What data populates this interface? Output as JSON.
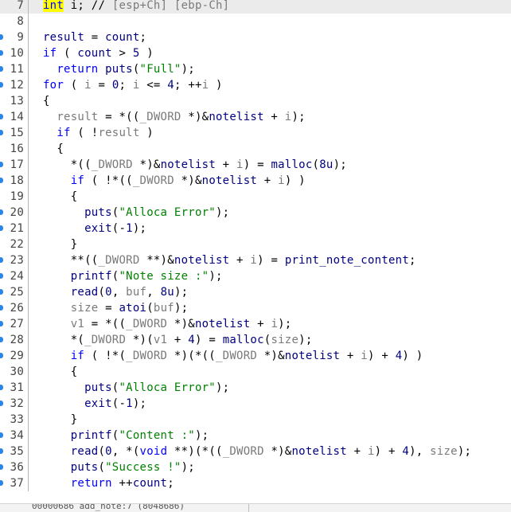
{
  "view": "pseudocode",
  "lines": [
    {
      "n": "7",
      "bp": false,
      "hl": true,
      "t": [
        [
          "hl",
          "int"
        ],
        [
          "p",
          " i; // "
        ],
        [
          "g",
          "[esp+Ch] [ebp-Ch]"
        ]
      ]
    },
    {
      "n": "8",
      "bp": false,
      "t": []
    },
    {
      "n": "9",
      "bp": true,
      "t": [
        [
          "i",
          "result"
        ],
        [
          "p",
          " = "
        ],
        [
          "i",
          "count"
        ],
        [
          "p",
          ";"
        ]
      ]
    },
    {
      "n": "10",
      "bp": true,
      "t": [
        [
          "k",
          "if"
        ],
        [
          "p",
          " ( "
        ],
        [
          "i",
          "count"
        ],
        [
          "p",
          " > "
        ],
        [
          "i",
          "5"
        ],
        [
          "p",
          " )"
        ]
      ]
    },
    {
      "n": "11",
      "bp": true,
      "t": [
        [
          "p",
          "  "
        ],
        [
          "k",
          "return"
        ],
        [
          "p",
          " "
        ],
        [
          "i",
          "puts"
        ],
        [
          "p",
          "("
        ],
        [
          "s",
          "\"Full\""
        ],
        [
          "p",
          ");"
        ]
      ]
    },
    {
      "n": "12",
      "bp": true,
      "t": [
        [
          "k",
          "for"
        ],
        [
          "p",
          " ( "
        ],
        [
          "g",
          "i"
        ],
        [
          "p",
          " = "
        ],
        [
          "i",
          "0"
        ],
        [
          "p",
          "; "
        ],
        [
          "g",
          "i"
        ],
        [
          "p",
          " <= "
        ],
        [
          "i",
          "4"
        ],
        [
          "p",
          "; ++"
        ],
        [
          "g",
          "i"
        ],
        [
          "p",
          " )"
        ]
      ]
    },
    {
      "n": "13",
      "bp": false,
      "t": [
        [
          "p",
          "{"
        ]
      ]
    },
    {
      "n": "14",
      "bp": true,
      "t": [
        [
          "p",
          "  "
        ],
        [
          "g",
          "result"
        ],
        [
          "p",
          " = *(("
        ],
        [
          "g",
          "_DWORD"
        ],
        [
          "p",
          " *)&"
        ],
        [
          "i",
          "notelist"
        ],
        [
          "p",
          " + "
        ],
        [
          "g",
          "i"
        ],
        [
          "p",
          ");"
        ]
      ]
    },
    {
      "n": "15",
      "bp": true,
      "t": [
        [
          "p",
          "  "
        ],
        [
          "k",
          "if"
        ],
        [
          "p",
          " ( !"
        ],
        [
          "g",
          "result"
        ],
        [
          "p",
          " )"
        ]
      ]
    },
    {
      "n": "16",
      "bp": false,
      "t": [
        [
          "p",
          "  {"
        ]
      ]
    },
    {
      "n": "17",
      "bp": true,
      "t": [
        [
          "p",
          "    *(("
        ],
        [
          "g",
          "_DWORD"
        ],
        [
          "p",
          " *)&"
        ],
        [
          "i",
          "notelist"
        ],
        [
          "p",
          " + "
        ],
        [
          "g",
          "i"
        ],
        [
          "p",
          ") = "
        ],
        [
          "i",
          "malloc"
        ],
        [
          "p",
          "("
        ],
        [
          "i",
          "8u"
        ],
        [
          "p",
          ");"
        ]
      ]
    },
    {
      "n": "18",
      "bp": true,
      "t": [
        [
          "p",
          "    "
        ],
        [
          "k",
          "if"
        ],
        [
          "p",
          " ( !*(("
        ],
        [
          "g",
          "_DWORD"
        ],
        [
          "p",
          " *)&"
        ],
        [
          "i",
          "notelist"
        ],
        [
          "p",
          " + "
        ],
        [
          "g",
          "i"
        ],
        [
          "p",
          ") )"
        ]
      ]
    },
    {
      "n": "19",
      "bp": false,
      "t": [
        [
          "p",
          "    {"
        ]
      ]
    },
    {
      "n": "20",
      "bp": true,
      "t": [
        [
          "p",
          "      "
        ],
        [
          "i",
          "puts"
        ],
        [
          "p",
          "("
        ],
        [
          "s",
          "\"Alloca Error\""
        ],
        [
          "p",
          ");"
        ]
      ]
    },
    {
      "n": "21",
      "bp": true,
      "t": [
        [
          "p",
          "      "
        ],
        [
          "i",
          "exit"
        ],
        [
          "p",
          "(-"
        ],
        [
          "i",
          "1"
        ],
        [
          "p",
          ");"
        ]
      ]
    },
    {
      "n": "22",
      "bp": false,
      "t": [
        [
          "p",
          "    }"
        ]
      ]
    },
    {
      "n": "23",
      "bp": true,
      "t": [
        [
          "p",
          "    **(("
        ],
        [
          "g",
          "_DWORD"
        ],
        [
          "p",
          " **)&"
        ],
        [
          "i",
          "notelist"
        ],
        [
          "p",
          " + "
        ],
        [
          "g",
          "i"
        ],
        [
          "p",
          ") = "
        ],
        [
          "i",
          "print_note_content"
        ],
        [
          "p",
          ";"
        ]
      ]
    },
    {
      "n": "24",
      "bp": true,
      "t": [
        [
          "p",
          "    "
        ],
        [
          "i",
          "printf"
        ],
        [
          "p",
          "("
        ],
        [
          "s",
          "\"Note size :\""
        ],
        [
          "p",
          ");"
        ]
      ]
    },
    {
      "n": "25",
      "bp": true,
      "t": [
        [
          "p",
          "    "
        ],
        [
          "i",
          "read"
        ],
        [
          "p",
          "("
        ],
        [
          "i",
          "0"
        ],
        [
          "p",
          ", "
        ],
        [
          "g",
          "buf"
        ],
        [
          "p",
          ", "
        ],
        [
          "i",
          "8u"
        ],
        [
          "p",
          ");"
        ]
      ]
    },
    {
      "n": "26",
      "bp": true,
      "t": [
        [
          "p",
          "    "
        ],
        [
          "g",
          "size"
        ],
        [
          "p",
          " = "
        ],
        [
          "i",
          "atoi"
        ],
        [
          "p",
          "("
        ],
        [
          "g",
          "buf"
        ],
        [
          "p",
          ");"
        ]
      ]
    },
    {
      "n": "27",
      "bp": true,
      "t": [
        [
          "p",
          "    "
        ],
        [
          "g",
          "v1"
        ],
        [
          "p",
          " = *(("
        ],
        [
          "g",
          "_DWORD"
        ],
        [
          "p",
          " *)&"
        ],
        [
          "i",
          "notelist"
        ],
        [
          "p",
          " + "
        ],
        [
          "g",
          "i"
        ],
        [
          "p",
          ");"
        ]
      ]
    },
    {
      "n": "28",
      "bp": true,
      "t": [
        [
          "p",
          "    *("
        ],
        [
          "g",
          "_DWORD"
        ],
        [
          "p",
          " *)("
        ],
        [
          "g",
          "v1"
        ],
        [
          "p",
          " + "
        ],
        [
          "i",
          "4"
        ],
        [
          "p",
          ") = "
        ],
        [
          "i",
          "malloc"
        ],
        [
          "p",
          "("
        ],
        [
          "g",
          "size"
        ],
        [
          "p",
          ");"
        ]
      ]
    },
    {
      "n": "29",
      "bp": true,
      "t": [
        [
          "p",
          "    "
        ],
        [
          "k",
          "if"
        ],
        [
          "p",
          " ( !*("
        ],
        [
          "g",
          "_DWORD"
        ],
        [
          "p",
          " *)(*(("
        ],
        [
          "g",
          "_DWORD"
        ],
        [
          "p",
          " *)&"
        ],
        [
          "i",
          "notelist"
        ],
        [
          "p",
          " + "
        ],
        [
          "g",
          "i"
        ],
        [
          "p",
          ") + "
        ],
        [
          "i",
          "4"
        ],
        [
          "p",
          ") )"
        ]
      ]
    },
    {
      "n": "30",
      "bp": false,
      "t": [
        [
          "p",
          "    {"
        ]
      ]
    },
    {
      "n": "31",
      "bp": true,
      "t": [
        [
          "p",
          "      "
        ],
        [
          "i",
          "puts"
        ],
        [
          "p",
          "("
        ],
        [
          "s",
          "\"Alloca Error\""
        ],
        [
          "p",
          ");"
        ]
      ]
    },
    {
      "n": "32",
      "bp": true,
      "t": [
        [
          "p",
          "      "
        ],
        [
          "i",
          "exit"
        ],
        [
          "p",
          "(-"
        ],
        [
          "i",
          "1"
        ],
        [
          "p",
          ");"
        ]
      ]
    },
    {
      "n": "33",
      "bp": false,
      "t": [
        [
          "p",
          "    }"
        ]
      ]
    },
    {
      "n": "34",
      "bp": true,
      "t": [
        [
          "p",
          "    "
        ],
        [
          "i",
          "printf"
        ],
        [
          "p",
          "("
        ],
        [
          "s",
          "\"Content :\""
        ],
        [
          "p",
          ");"
        ]
      ]
    },
    {
      "n": "35",
      "bp": true,
      "t": [
        [
          "p",
          "    "
        ],
        [
          "i",
          "read"
        ],
        [
          "p",
          "("
        ],
        [
          "i",
          "0"
        ],
        [
          "p",
          ", *("
        ],
        [
          "k",
          "void"
        ],
        [
          "p",
          " **)(*(("
        ],
        [
          "g",
          "_DWORD"
        ],
        [
          "p",
          " *)&"
        ],
        [
          "i",
          "notelist"
        ],
        [
          "p",
          " + "
        ],
        [
          "g",
          "i"
        ],
        [
          "p",
          ") + "
        ],
        [
          "i",
          "4"
        ],
        [
          "p",
          "), "
        ],
        [
          "g",
          "size"
        ],
        [
          "p",
          ");"
        ]
      ]
    },
    {
      "n": "36",
      "bp": true,
      "t": [
        [
          "p",
          "    "
        ],
        [
          "i",
          "puts"
        ],
        [
          "p",
          "("
        ],
        [
          "s",
          "\"Success !\""
        ],
        [
          "p",
          ");"
        ]
      ]
    },
    {
      "n": "37",
      "bp": true,
      "t": [
        [
          "p",
          "    "
        ],
        [
          "k",
          "return"
        ],
        [
          "p",
          " ++"
        ],
        [
          "i",
          "count"
        ],
        [
          "p",
          ";"
        ]
      ]
    }
  ],
  "statusbar": {
    "text": "00000686 add_note:7 (8048686)"
  }
}
